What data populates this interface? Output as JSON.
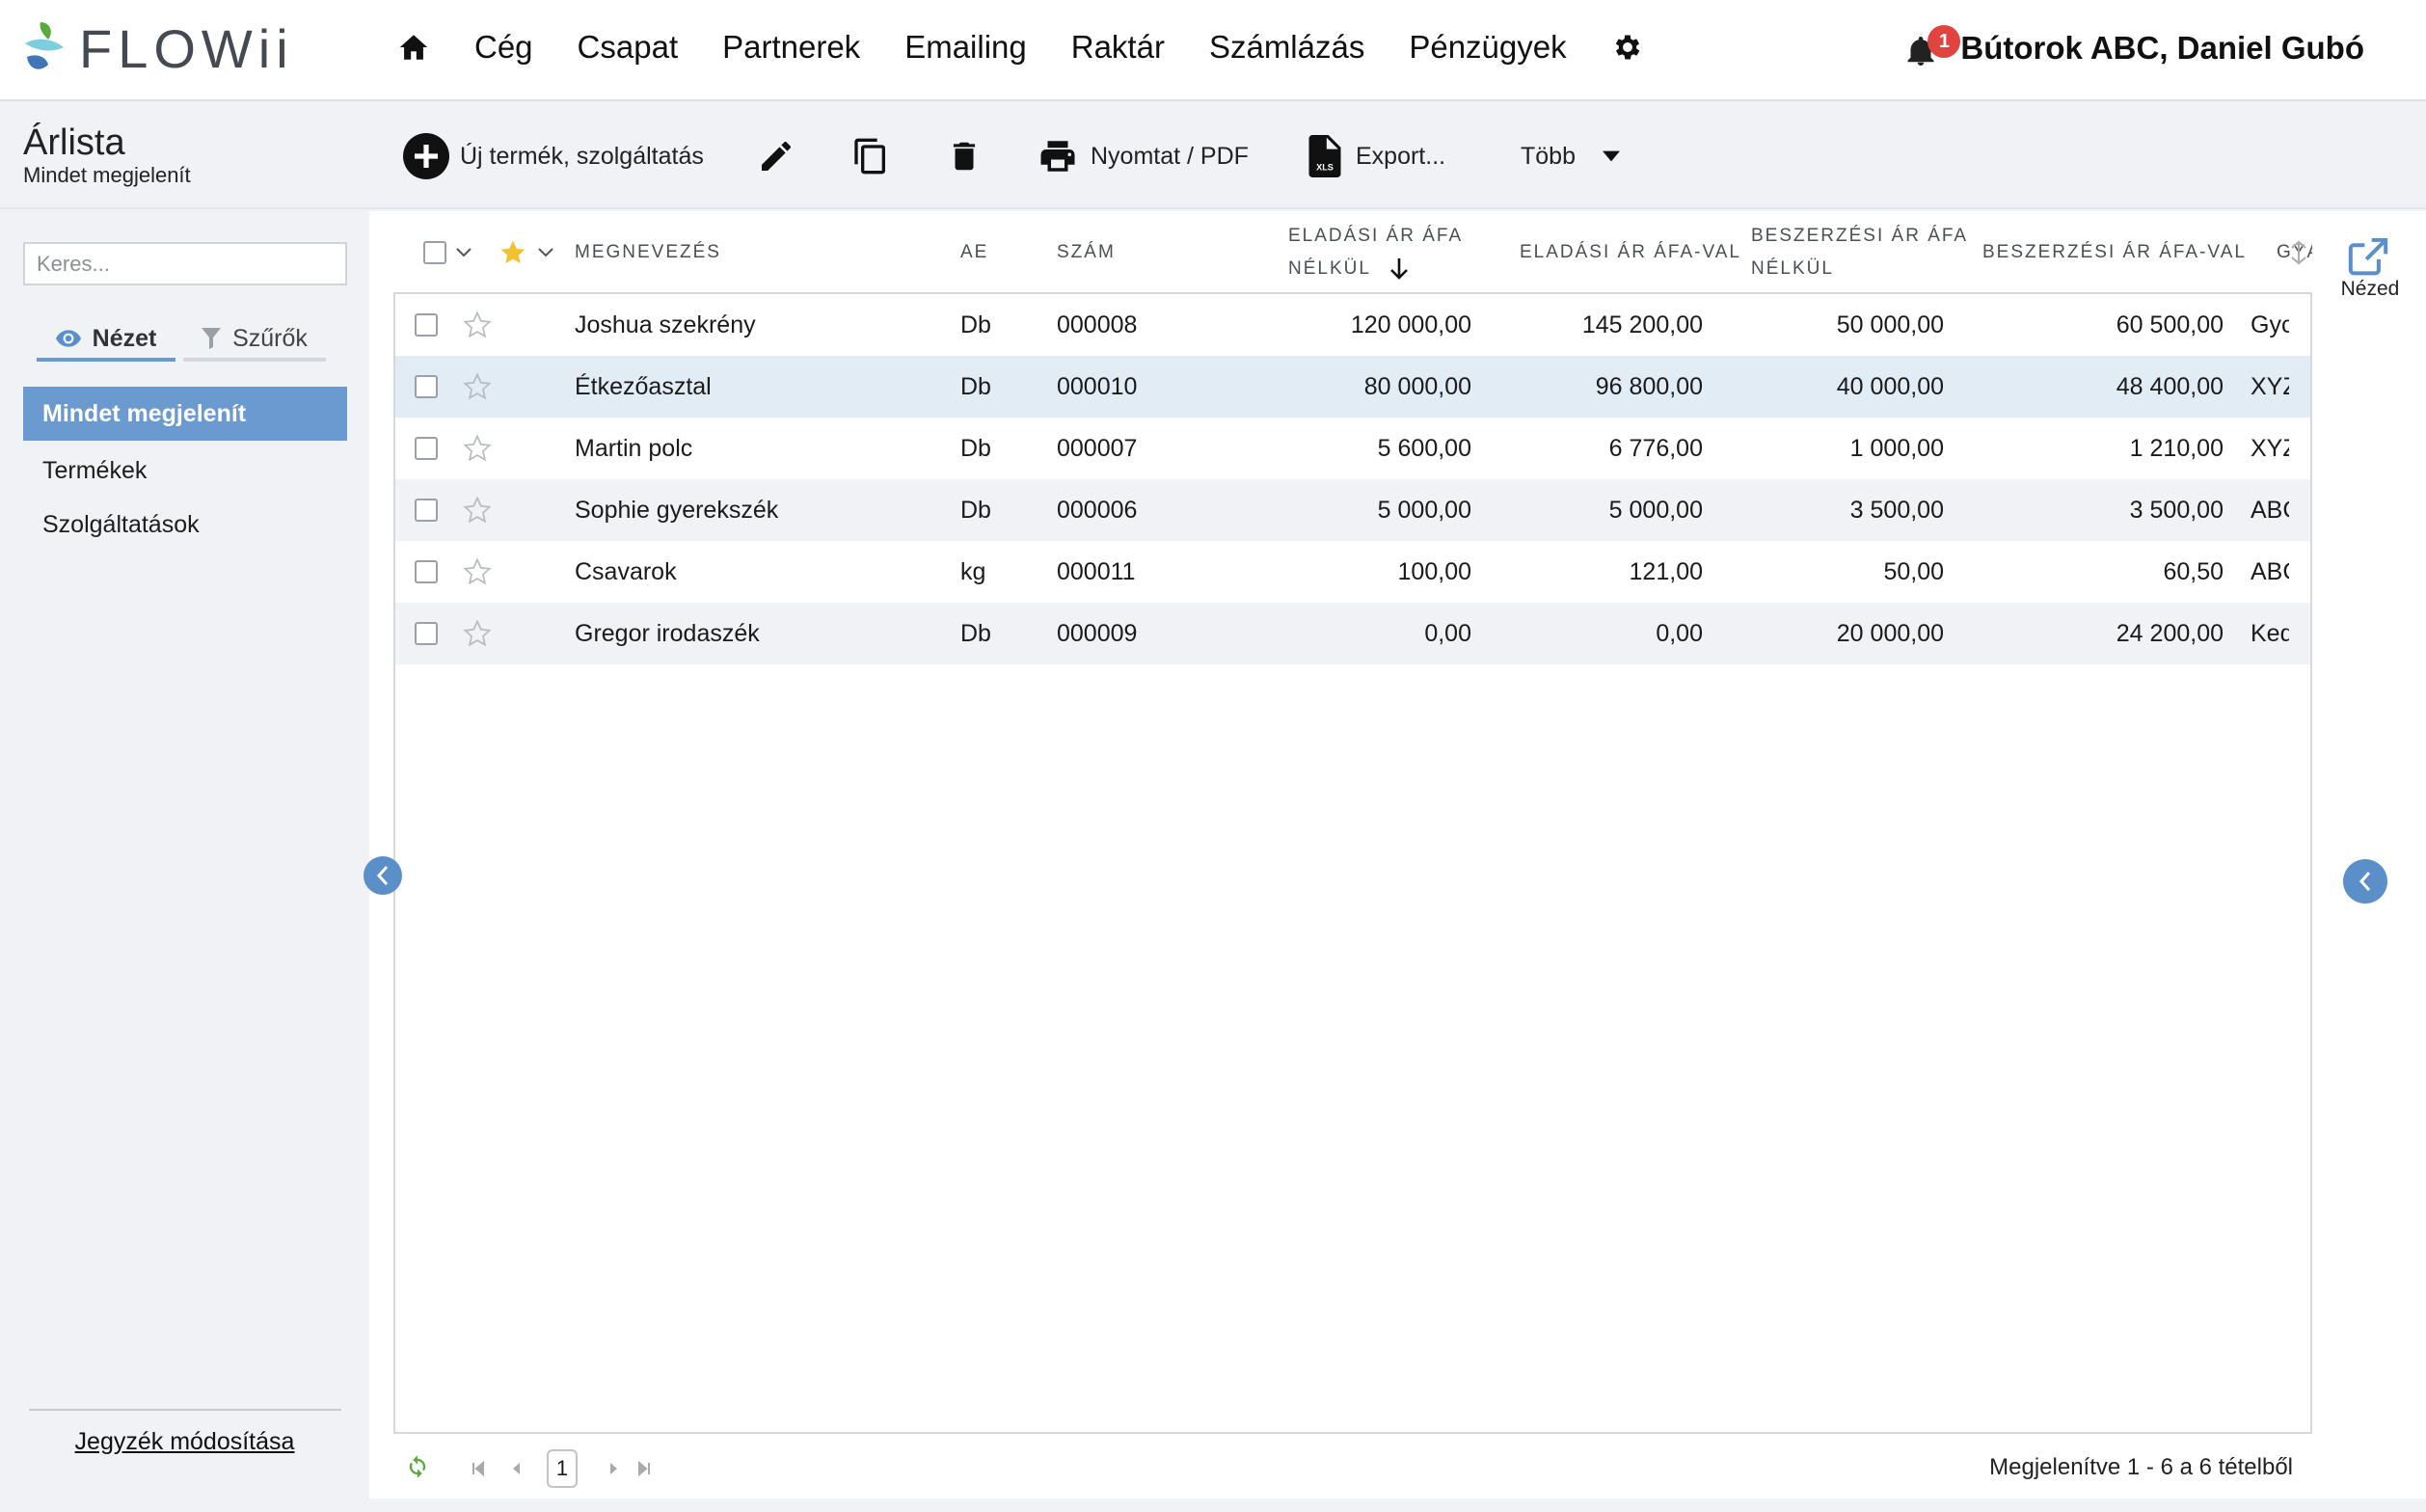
{
  "app": {
    "logo_text": "FLOWii",
    "nav": [
      "Cég",
      "Csapat",
      "Partnerek",
      "Emailing",
      "Raktár",
      "Számlázás",
      "Pénzügyek"
    ],
    "notification_count": "1",
    "user_label": "Bútorok ABC, Daniel Gubó"
  },
  "toolbar": {
    "page_title": "Árlista",
    "page_subtitle": "Mindet megjelenít",
    "new_label": "Új termék, szolgáltatás",
    "print_label": "Nyomtat / PDF",
    "export_label": "Export...",
    "xls_label": "XLS",
    "more_label": "Több"
  },
  "sidebar": {
    "search_placeholder": "Keres...",
    "tab_view": "Nézet",
    "tab_filter": "Szűrők",
    "items": [
      "Mindet megjelenít",
      "Termékek",
      "Szolgáltatások"
    ],
    "edit_link": "Jegyzék módosítása"
  },
  "table": {
    "headers": {
      "name": "MEGNEVEZÉS",
      "unit": "AE",
      "number": "SZÁM",
      "sell_net_1": "ELADÁSI ÁR ÁFA",
      "sell_net_2": "NÉLKÜL",
      "sell_gross": "ELADÁSI ÁR ÁFA-VAL",
      "buy_net_1": "BESZERZÉSI ÁR ÁFA",
      "buy_net_2": "NÉLKÜL",
      "buy_gross": "BESZERZÉSI ÁR ÁFA-VAL",
      "supplier": "GYÁ"
    },
    "rows": [
      {
        "name": "Joshua szekrény",
        "unit": "Db",
        "number": "000008",
        "sell_net": "120 000,00",
        "sell_gross": "145 200,00",
        "buy_net": "50 000,00",
        "buy_gross": "60 500,00",
        "supplier": "Gyc"
      },
      {
        "name": "Étkezőasztal",
        "unit": "Db",
        "number": "000010",
        "sell_net": "80 000,00",
        "sell_gross": "96 800,00",
        "buy_net": "40 000,00",
        "buy_gross": "48 400,00",
        "supplier": "XYZ"
      },
      {
        "name": "Martin polc",
        "unit": "Db",
        "number": "000007",
        "sell_net": "5 600,00",
        "sell_gross": "6 776,00",
        "buy_net": "1 000,00",
        "buy_gross": "1 210,00",
        "supplier": "XYZ"
      },
      {
        "name": "Sophie gyerekszék",
        "unit": "Db",
        "number": "000006",
        "sell_net": "5 000,00",
        "sell_gross": "5 000,00",
        "buy_net": "3 500,00",
        "buy_gross": "3 500,00",
        "supplier": "ABC"
      },
      {
        "name": "Csavarok",
        "unit": "kg",
        "number": "000011",
        "sell_net": "100,00",
        "sell_gross": "121,00",
        "buy_net": "50,00",
        "buy_gross": "60,50",
        "supplier": "ABC"
      },
      {
        "name": "Gregor irodaszék",
        "unit": "Db",
        "number": "000009",
        "sell_net": "0,00",
        "sell_gross": "0,00",
        "buy_net": "20 000,00",
        "buy_gross": "24 200,00",
        "supplier": "Ked"
      }
    ]
  },
  "pager": {
    "current_page": "1",
    "info": "Megjelenítve 1 - 6 a 6 tételből"
  },
  "right_panel": {
    "view_label": "Nézed"
  },
  "colors": {
    "accent": "#6a9ad0",
    "collapse_button": "#5b8fca",
    "badge": "#e0443e",
    "star_active": "#f2c230",
    "refresh": "#5aaa3c"
  }
}
